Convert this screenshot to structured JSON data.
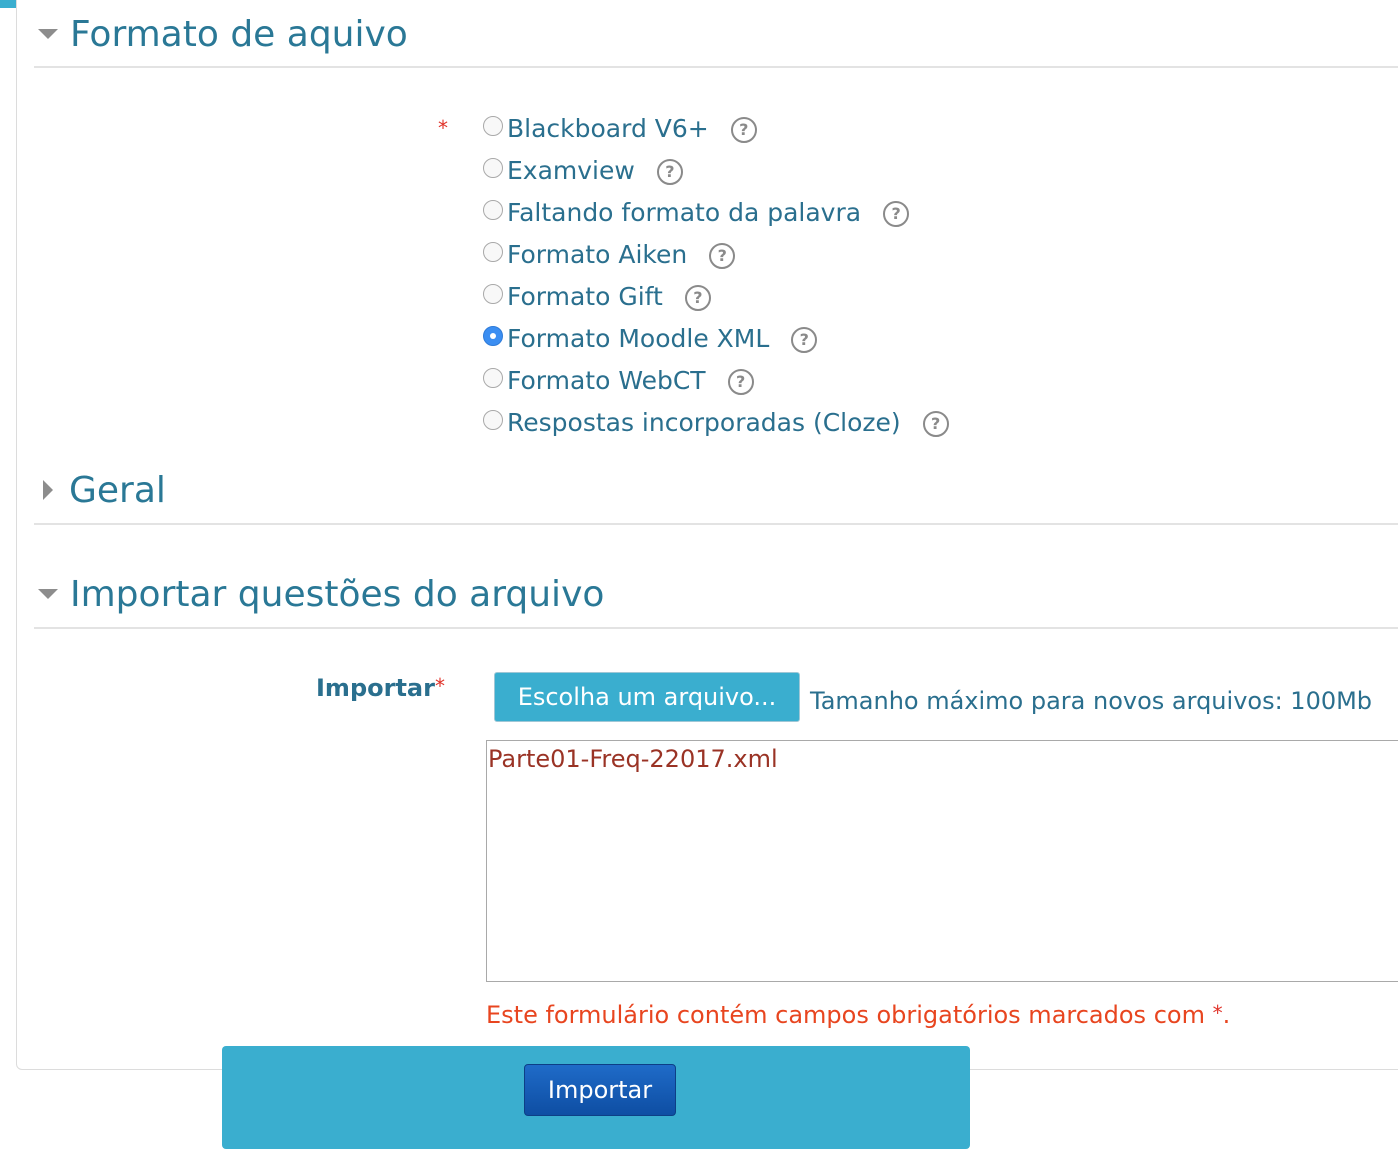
{
  "sections": {
    "file_format": {
      "title": "Formato de aquivo",
      "expanded": true
    },
    "general": {
      "title": "Geral",
      "expanded": false
    },
    "import_file": {
      "title": "Importar questões do arquivo",
      "expanded": true
    }
  },
  "required_marker": "*",
  "formats": [
    {
      "label": "Blackboard V6+",
      "checked": false
    },
    {
      "label": "Examview",
      "checked": false
    },
    {
      "label": "Faltando formato da palavra",
      "checked": false
    },
    {
      "label": "Formato Aiken",
      "checked": false
    },
    {
      "label": "Formato Gift",
      "checked": false
    },
    {
      "label": "Formato Moodle XML",
      "checked": true
    },
    {
      "label": "Formato WebCT",
      "checked": false
    },
    {
      "label": "Respostas incorporadas (Cloze)",
      "checked": false
    }
  ],
  "import_field": {
    "label": "Importar",
    "choose_button": "Escolha um arquivo...",
    "max_size": "Tamanho máximo para novos arquivos: 100Mb",
    "selected_file": "Parte01-Freq-22017.xml"
  },
  "required_note": {
    "text": "Este formulário contém campos obrigatórios marcados com ",
    "star": "*",
    "end": "."
  },
  "submit_label": "Importar",
  "icons": {
    "help": "help-circle-icon",
    "expand": "caret-down-icon",
    "collapse": "caret-right-icon"
  },
  "colors": {
    "accent": "#3aaecf",
    "link_text": "#2a7896",
    "required": "#e0332a",
    "primary_button": "#1f6bc8"
  }
}
